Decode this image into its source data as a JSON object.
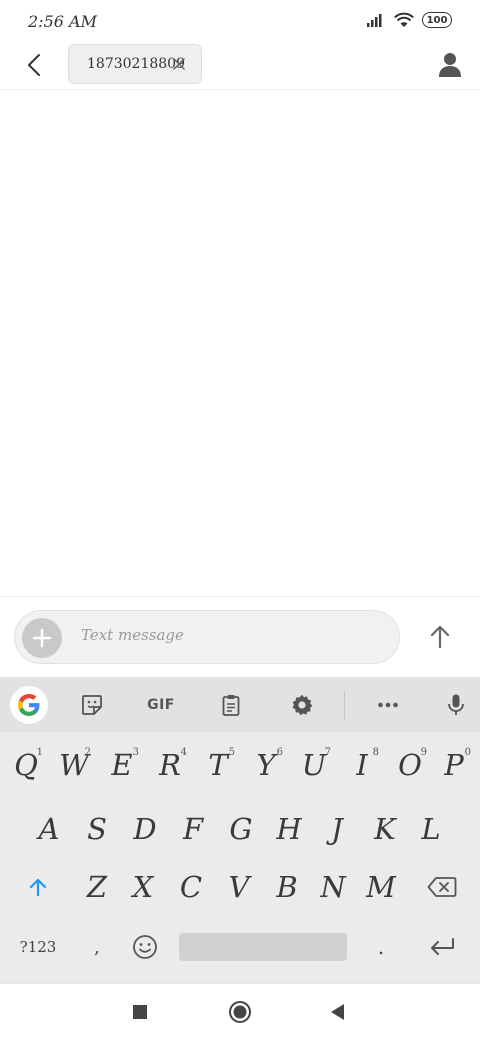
{
  "status_bar": {
    "time": "2:56 AM",
    "battery": "100"
  },
  "header": {
    "recipient": "18730218809"
  },
  "compose": {
    "placeholder": "Text message"
  },
  "keyboard": {
    "toolbar": {
      "gif_label": "GIF"
    },
    "rows": [
      [
        {
          "label": "Q",
          "hint": "1"
        },
        {
          "label": "W",
          "hint": "2"
        },
        {
          "label": "E",
          "hint": "3"
        },
        {
          "label": "R",
          "hint": "4"
        },
        {
          "label": "T",
          "hint": "5"
        },
        {
          "label": "Y",
          "hint": "6"
        },
        {
          "label": "U",
          "hint": "7"
        },
        {
          "label": "I",
          "hint": "8"
        },
        {
          "label": "O",
          "hint": "9"
        },
        {
          "label": "P",
          "hint": "0"
        }
      ],
      [
        {
          "label": "A"
        },
        {
          "label": "S"
        },
        {
          "label": "D"
        },
        {
          "label": "F"
        },
        {
          "label": "G"
        },
        {
          "label": "H"
        },
        {
          "label": "J"
        },
        {
          "label": "K"
        },
        {
          "label": "L"
        }
      ],
      [
        {
          "label": "Z"
        },
        {
          "label": "X"
        },
        {
          "label": "C"
        },
        {
          "label": "V"
        },
        {
          "label": "B"
        },
        {
          "label": "N"
        },
        {
          "label": "M"
        }
      ]
    ],
    "bottom_row": {
      "symbols_label": "?123",
      "comma_label": ",",
      "period_label": "."
    }
  },
  "colors": {
    "accent": "#2196f3",
    "keyboard_bg": "#ebebeb",
    "toolbar_bg": "#e2e2e2"
  }
}
